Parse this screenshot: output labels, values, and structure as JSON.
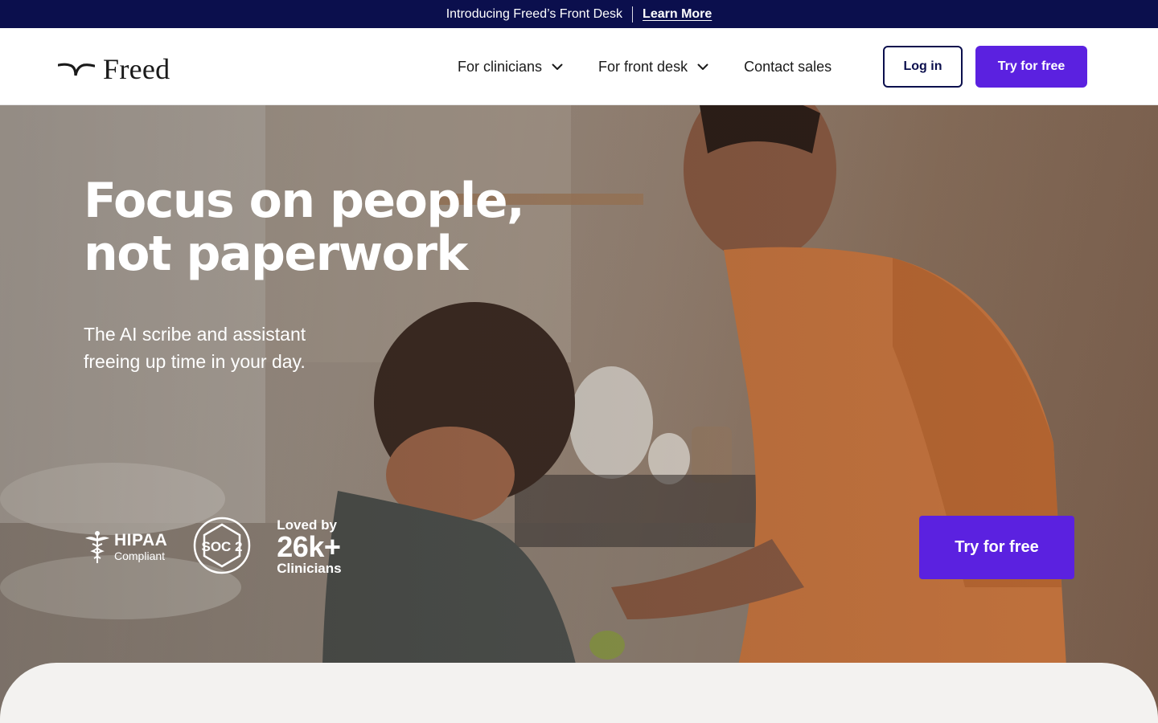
{
  "announcement": {
    "text": "Introducing Freed’s Front Desk",
    "link_label": "Learn More"
  },
  "header": {
    "logo_text": "Freed",
    "nav": [
      {
        "label": "For clinicians",
        "has_dropdown": true
      },
      {
        "label": "For front desk",
        "has_dropdown": true
      },
      {
        "label": "Contact sales",
        "has_dropdown": false
      }
    ],
    "login_label": "Log in",
    "try_label": "Try for free"
  },
  "hero": {
    "headline_line1": "Focus on people,",
    "headline_line2": "not paperwork",
    "subhead_line1": "The AI scribe and assistant",
    "subhead_line2": "freeing up time in your day.",
    "badges": {
      "hipaa_main": "HIPAA",
      "hipaa_sub": "Compliant",
      "soc_label": "SOC 2",
      "loved_top": "Loved by",
      "loved_count": "26k+",
      "loved_bottom": "Clinicians"
    },
    "cta_label": "Try for free"
  },
  "colors": {
    "announcement_bg": "#0b0f4d",
    "accent": "#5b21e0",
    "text_dark": "#1a1a1a"
  },
  "icons": [
    "freed-logo-icon",
    "chevron-down-icon",
    "caduceus-icon",
    "soc2-hexagon-icon"
  ]
}
